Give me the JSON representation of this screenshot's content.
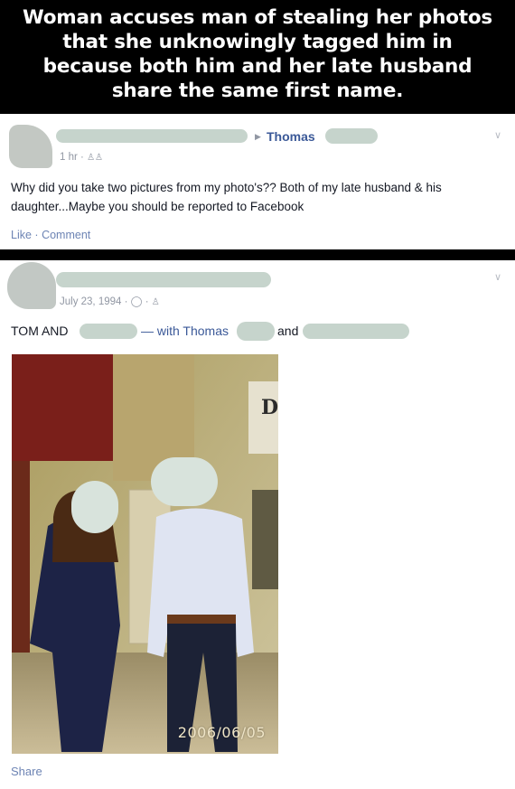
{
  "caption": {
    "text": "Woman accuses man of stealing her photos that she unknowingly tagged him in because both him and her late husband share the same first name."
  },
  "comment_post": {
    "tagged_name": "Thomas",
    "time": "1 hr",
    "text": "Why did you take two pictures from my photo's?? Both of my late husband & his daughter...Maybe you should be reported to Facebook",
    "like_label": "Like",
    "comment_label": "Comment",
    "separator": "·"
  },
  "photo_post": {
    "date": "July 23, 1994",
    "caption_start": "TOM AND",
    "with_label": "— with Thomas",
    "and_label": "and",
    "photo_timestamp": "2006/06/05",
    "sign_text": "D",
    "share_label": "Share"
  },
  "icons": {
    "dropdown": "chevron-down-icon",
    "arrow": "triangle-right-icon",
    "privacy": "friends-icon",
    "clock": "clock-icon"
  },
  "colors": {
    "link": "#3b5998",
    "meta": "#9197a3",
    "text": "#141823",
    "redaction": "#c6d4cc"
  }
}
